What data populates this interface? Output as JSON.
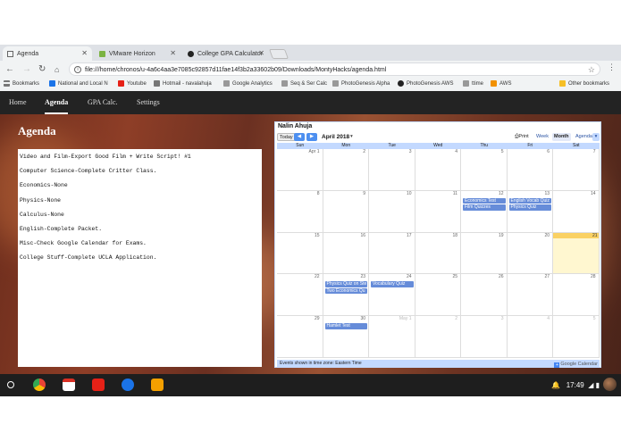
{
  "browser": {
    "tabs": [
      {
        "title": "Agenda",
        "icon": "document-icon",
        "active": true
      },
      {
        "title": "VMware Horizon",
        "icon": "vmware-icon",
        "active": false
      },
      {
        "title": "College GPA Calculator",
        "icon": "github-icon",
        "active": false
      }
    ],
    "url": "file:///home/chronos/u-4a6c4aa3e7085c92857d11fae14f3b2a33602b09/Downloads/MontyHacks/agenda.html",
    "bookmarks_label": "Bookmarks",
    "bookmarks": [
      {
        "label": "National and Local N",
        "icon": "news-icon",
        "color": "#1a73e8"
      },
      {
        "label": "Youtube",
        "icon": "youtube-icon",
        "color": "#e62117"
      },
      {
        "label": "Hotmail - navalahuja",
        "icon": "hotmail-icon",
        "color": "#777777"
      },
      {
        "label": "Google Analytics",
        "icon": "analytics-icon",
        "color": "#999999"
      },
      {
        "label": "Seq & Ser Calc",
        "icon": "document-icon",
        "color": "#999999"
      },
      {
        "label": "PhotoGenesis Alpha",
        "icon": "document-icon",
        "color": "#999999"
      },
      {
        "label": "PhotoGenesis AWS",
        "icon": "github-icon",
        "color": "#222222"
      },
      {
        "label": "ttime",
        "icon": "document-icon",
        "color": "#999999"
      },
      {
        "label": "AWS",
        "icon": "aws-icon",
        "color": "#f29100"
      }
    ],
    "other_bookmarks": "Other bookmarks"
  },
  "nav": {
    "items": [
      {
        "label": "Home",
        "active": false
      },
      {
        "label": "Agenda",
        "active": true
      },
      {
        "label": "GPA Calc.",
        "active": false
      },
      {
        "label": "Settings",
        "active": false
      }
    ]
  },
  "page_title": "Agenda",
  "notes": [
    "Video and Film-Export Good Film + Write Script! #1",
    "Computer Science-Complete Critter Class.",
    "Economics-None",
    "Physics-None",
    "Calculus-None",
    "English-Complete Packet.",
    "Misc-Check Google Calendar for Exams.",
    "College Stuff-Complete UCLA Application."
  ],
  "calendar": {
    "owner": "Nalin Ahuja",
    "today_label": "Today",
    "month_label": "April 2018",
    "print_label": "Print",
    "views": [
      "Week",
      "Month",
      "Agenda"
    ],
    "active_view": "Month",
    "day_names": [
      "Sun",
      "Mon",
      "Tue",
      "Wed",
      "Thu",
      "Fri",
      "Sat"
    ],
    "weeks": [
      [
        {
          "d": "Apr 1"
        },
        {
          "d": "2"
        },
        {
          "d": "3"
        },
        {
          "d": "4"
        },
        {
          "d": "5"
        },
        {
          "d": "6"
        },
        {
          "d": "7"
        }
      ],
      [
        {
          "d": "8"
        },
        {
          "d": "9"
        },
        {
          "d": "10"
        },
        {
          "d": "11"
        },
        {
          "d": "12"
        },
        {
          "d": "13"
        },
        {
          "d": "14"
        }
      ],
      [
        {
          "d": "15"
        },
        {
          "d": "16"
        },
        {
          "d": "17"
        },
        {
          "d": "18"
        },
        {
          "d": "19"
        },
        {
          "d": "20"
        },
        {
          "d": "21",
          "today": true
        }
      ],
      [
        {
          "d": "22"
        },
        {
          "d": "23"
        },
        {
          "d": "24"
        },
        {
          "d": "25"
        },
        {
          "d": "26"
        },
        {
          "d": "27"
        },
        {
          "d": "28"
        }
      ],
      [
        {
          "d": "29"
        },
        {
          "d": "30"
        },
        {
          "d": "May 1",
          "other": true
        },
        {
          "d": "2",
          "other": true
        },
        {
          "d": "3",
          "other": true
        },
        {
          "d": "4",
          "other": true
        },
        {
          "d": "5",
          "other": true
        }
      ]
    ],
    "events": [
      {
        "week": 1,
        "day": 4,
        "title": "Economics Test"
      },
      {
        "week": 1,
        "day": 4,
        "title": "Film Quizzes"
      },
      {
        "week": 1,
        "day": 5,
        "title": "English Vocab Quiz"
      },
      {
        "week": 1,
        "day": 5,
        "title": "Physics Quiz"
      },
      {
        "week": 3,
        "day": 1,
        "title": "Physics Quiz on Ste"
      },
      {
        "week": 3,
        "day": 1,
        "title": "Two Economics Qu"
      },
      {
        "week": 3,
        "day": 2,
        "title": "Vocabulary Quiz"
      },
      {
        "week": 4,
        "day": 1,
        "title": "Hamlet Test"
      }
    ],
    "footer": "Events shown in time zone: Eastern Time",
    "brand": "Google Calendar"
  },
  "shelf": {
    "apps": [
      {
        "name": "chrome-icon",
        "color": "#4285f4"
      },
      {
        "name": "gmail-icon",
        "color": "#d93025"
      },
      {
        "name": "youtube-icon",
        "color": "#e62117"
      },
      {
        "name": "files-icon",
        "color": "#1a73e8"
      },
      {
        "name": "crosh-icon",
        "color": "#f4a000"
      }
    ],
    "time": "17:49"
  }
}
